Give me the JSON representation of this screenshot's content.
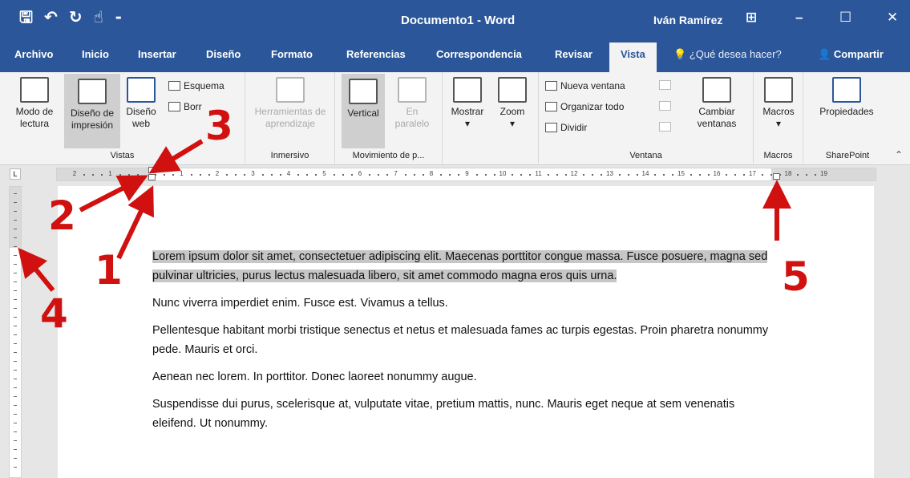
{
  "titlebar": {
    "doc_title": "Documento1 - Word",
    "user": "Iván Ramírez",
    "qat_save": "🖫",
    "qat_undo": "↶",
    "qat_redo": "↻",
    "qat_touch": "☝",
    "qat_more": "⁃",
    "ctrl_ribbon": "⊞",
    "ctrl_min": "–",
    "ctrl_max": "☐",
    "ctrl_close": "✕"
  },
  "tabs": [
    "Archivo",
    "Inicio",
    "Insertar",
    "Diseño",
    "Formato",
    "Referencias",
    "Correspondencia",
    "Revisar",
    "Vista"
  ],
  "active_tab": "Vista",
  "tell_me": "¿Qué desea hacer?",
  "share": "Compartir",
  "ribbon": {
    "vistas": {
      "label": "Vistas",
      "modo_lectura": "Modo de lectura",
      "diseno_impresion": "Diseño de impresión",
      "diseno_web": "Diseño web",
      "esquema": "Esquema",
      "borrador": "Borr"
    },
    "inmersivo": {
      "label": "Inmersivo",
      "herramientas": "Herramientas de aprendizaje"
    },
    "movimiento": {
      "label": "Movimiento de p...",
      "vertical": "Vertical",
      "en_paralelo": "En paralelo"
    },
    "mostrar": {
      "label": "Mostrar"
    },
    "zoom": {
      "label": "Zoom"
    },
    "ventana": {
      "label": "Ventana",
      "nueva_ventana": "Nueva ventana",
      "organizar_todo": "Organizar todo",
      "dividir": "Dividir",
      "cambiar_ventanas": "Cambiar ventanas"
    },
    "macros": {
      "label": "Macros",
      "button": "Macros"
    },
    "sharepoint": {
      "label": "SharePoint",
      "propiedades": "Propiedades"
    }
  },
  "ruler": {
    "numbers": [
      "2",
      "1",
      "",
      "1",
      "2",
      "3",
      "4",
      "5",
      "6",
      "7",
      "8",
      "9",
      "10",
      "11",
      "12",
      "13",
      "14",
      "15",
      "16",
      "17",
      "18",
      "19"
    ]
  },
  "document": {
    "paragraphs": [
      "Lorem ipsum dolor sit amet, consectetuer adipiscing elit. Maecenas porttitor congue massa. Fusce posuere, magna sed pulvinar ultricies, purus lectus malesuada libero, sit amet commodo magna eros quis urna.",
      "Nunc viverra imperdiet enim. Fusce est. Vivamus a tellus.",
      "Pellentesque habitant morbi tristique senectus et netus et malesuada fames ac turpis egestas. Proin pharetra nonummy pede. Mauris et orci.",
      "Aenean nec lorem. In porttitor. Donec laoreet nonummy augue.",
      "Suspendisse dui purus, scelerisque at, vulputate vitae, pretium mattis, nunc. Mauris eget neque at sem venenatis eleifend. Ut nonummy."
    ]
  },
  "annotations": [
    "1",
    "2",
    "3",
    "4",
    "5"
  ],
  "colors": {
    "accent": "#2b579a",
    "annotation": "#d11010",
    "highlight": "#c6c6c6"
  }
}
